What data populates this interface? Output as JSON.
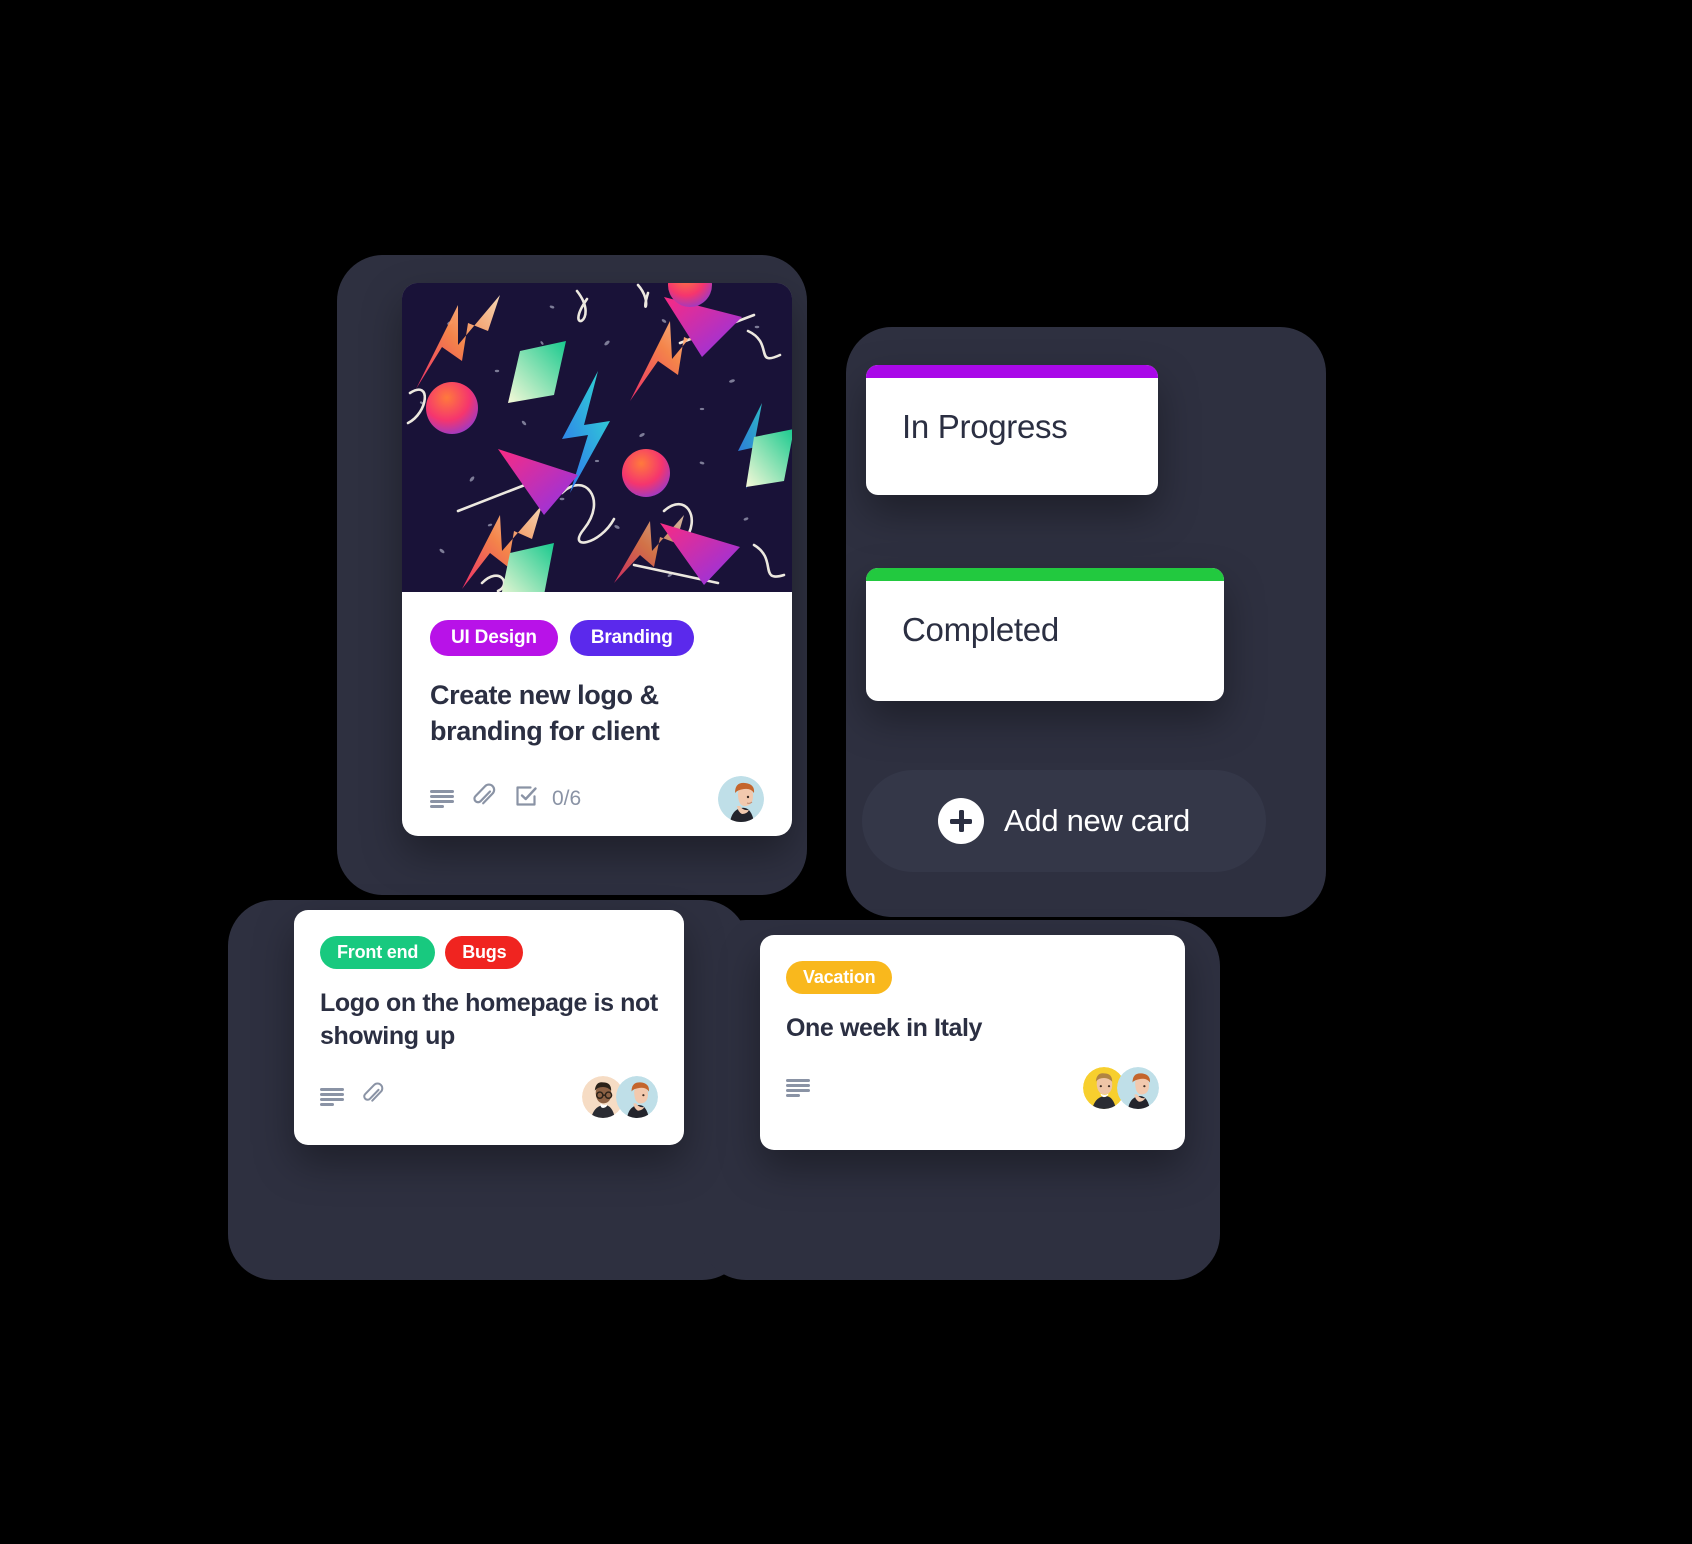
{
  "theme": {
    "background": "#000000",
    "panel_color": "#2e3040",
    "card_color": "#ffffff",
    "text_dark": "#2b2f42",
    "meta_gray": "#8a93a5",
    "purple_accent": "#a908e8",
    "green_accent": "#22c93f",
    "tag_ui_design": "#b812e8",
    "tag_branding": "#5b29ec",
    "tag_front_end": "#18c97f",
    "tag_bugs": "#f02420",
    "tag_vacation": "#f9b81d",
    "add_button_bg": "#343748"
  },
  "columns": [
    {
      "name": "in-progress",
      "label": "In Progress",
      "strip_color": "#a908e8"
    },
    {
      "name": "completed",
      "label": "Completed",
      "strip_color": "#22c93f"
    }
  ],
  "add_card": {
    "label": "Add new card",
    "icon": "plus-icon"
  },
  "cards": {
    "featured": {
      "cover": {
        "icon": "memphis-pattern-cover",
        "background": "#191238"
      },
      "tags": [
        {
          "label": "UI Design",
          "color": "#b812e8"
        },
        {
          "label": "Branding",
          "color": "#5b29ec"
        }
      ],
      "title": "Create new logo & branding for client",
      "meta": {
        "description_icon": "description-lines-icon",
        "attachment_icon": "paperclip-icon",
        "checklist_icon": "checklist-icon",
        "checklist_count": "0/6"
      },
      "members": [
        {
          "name": "avatar-red-haired-woman",
          "bg": "#bfdfe8",
          "hair": "#c4652c",
          "skin": "#f2c9ae",
          "shirt": "#23242c"
        }
      ]
    },
    "logo_bug": {
      "tags": [
        {
          "label": "Front end",
          "color": "#18c97f"
        },
        {
          "label": "Bugs",
          "color": "#f02420"
        }
      ],
      "title": "Logo on the homepage is not showing up",
      "meta": {
        "description_icon": "description-lines-icon",
        "attachment_icon": "paperclip-icon"
      },
      "members": [
        {
          "name": "avatar-man-with-glasses",
          "bg": "#f6dcc4",
          "hair": "#2b2118",
          "skin": "#8d6144",
          "shirt": "#2b2c33"
        },
        {
          "name": "avatar-red-haired-woman",
          "bg": "#bfdfe8",
          "hair": "#c4652c",
          "skin": "#f2c9ae",
          "shirt": "#23242c"
        }
      ]
    },
    "italy": {
      "tags": [
        {
          "label": "Vacation",
          "color": "#f9b81d"
        }
      ],
      "title": "One week in Italy",
      "meta": {
        "description_icon": "description-lines-icon"
      },
      "members": [
        {
          "name": "avatar-blond-man",
          "bg": "#f7cf2e",
          "hair": "#b08443",
          "skin": "#eec5a6",
          "shirt": "#2b2c33"
        },
        {
          "name": "avatar-red-haired-woman",
          "bg": "#bfdfe8",
          "hair": "#c4652c",
          "skin": "#f2c9ae",
          "shirt": "#23242c"
        }
      ]
    }
  }
}
